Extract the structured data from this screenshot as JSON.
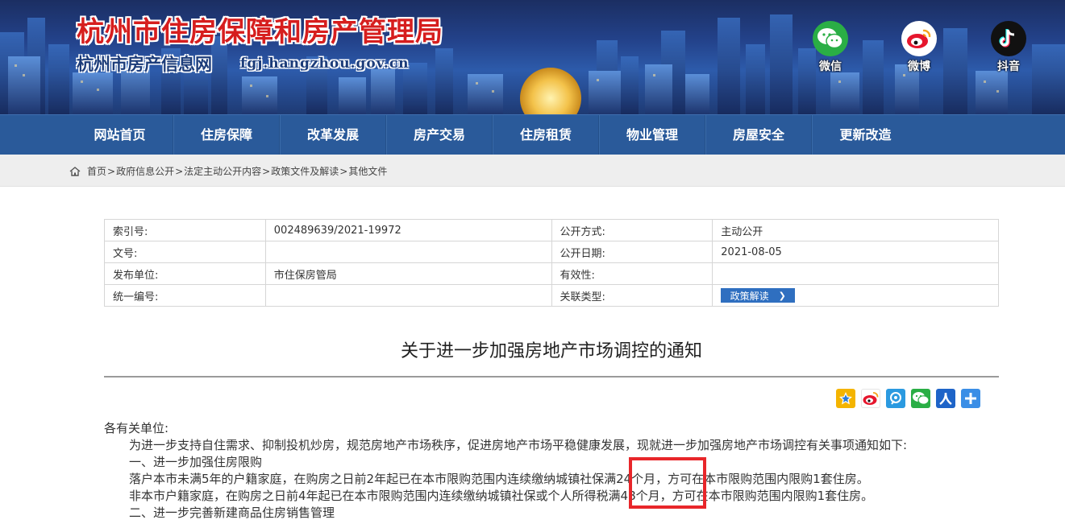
{
  "header": {
    "title": "杭州市住房保障和房产管理局",
    "subtitle": "杭州市房产信息网",
    "domain": "fgj.hangzhou.gov.cn",
    "social": [
      {
        "label": "微信",
        "icon": "wechat-icon",
        "color": "#2aae45"
      },
      {
        "label": "微博",
        "icon": "weibo-icon",
        "color": "#e6162d"
      },
      {
        "label": "抖音",
        "icon": "douyin-icon",
        "color": "#111111"
      }
    ]
  },
  "nav": {
    "items": [
      "网站首页",
      "住房保障",
      "改革发展",
      "房产交易",
      "住房租赁",
      "物业管理",
      "房屋安全",
      "更新改造"
    ],
    "color": "#2a5a9a"
  },
  "breadcrumb": {
    "items": [
      "首页",
      "政府信息公开",
      "法定主动公开内容",
      "政策文件及解读",
      "其他文件"
    ],
    "separator": ">"
  },
  "meta": {
    "rows": [
      {
        "k1": "索引号:",
        "v1": "002489639/2021-19972",
        "k2": "公开方式:",
        "v2": "主动公开"
      },
      {
        "k1": "文号:",
        "v1": "",
        "k2": "公开日期:",
        "v2": "2021-08-05"
      },
      {
        "k1": "发布单位:",
        "v1": "市住保房管局",
        "k2": "有效性:",
        "v2": ""
      },
      {
        "k1": "统一编号:",
        "v1": "",
        "k2": "关联类型:",
        "v2": ""
      }
    ],
    "policy_button": "政策解读"
  },
  "article": {
    "title": "关于进一步加强房地产市场调控的通知",
    "share_icons": [
      "qzone-icon",
      "weibo-share-icon",
      "tencent-weibo-icon",
      "wechat-share-icon",
      "renren-icon",
      "more-share-icon"
    ],
    "paragraphs": [
      {
        "text": "各有关单位:",
        "indent": false
      },
      {
        "text": "为进一步支持自住需求、抑制投机炒房，规范房地产市场秩序，促进房地产市场平稳健康发展，现就进一步加强房地产市场调控有关事项通知如下:",
        "indent": true
      },
      {
        "text": "一、进一步加强住房限购",
        "indent": true
      },
      {
        "text": "落户本市未满5年的户籍家庭，在购房之日前2年起已在本市限购范围内连续缴纳城镇社保满24个月，方可在本市限购范围内限购1套住房。",
        "indent": true
      },
      {
        "text": "非本市户籍家庭，在购房之日前4年起已在本市限购范围内连续缴纳城镇社保或个人所得税满48个月，方可在本市限购范围内限购1套住房。",
        "indent": true
      },
      {
        "text": "二、进一步完善新建商品住房销售管理",
        "indent": true
      }
    ],
    "highlight_color": "#e8262a"
  }
}
